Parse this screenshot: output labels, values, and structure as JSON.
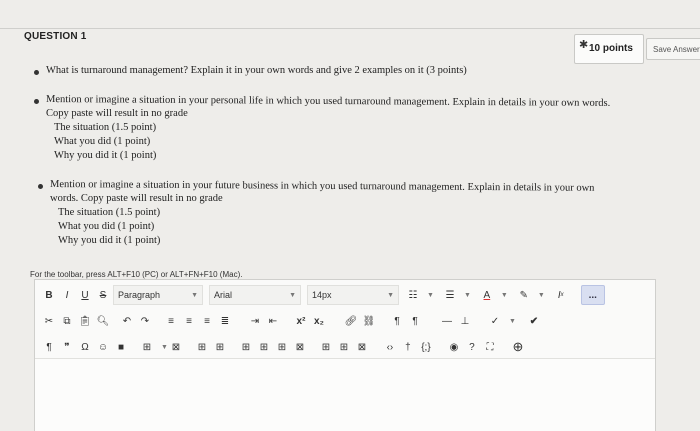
{
  "question": {
    "title": "QUESTION 1",
    "points": "10 points",
    "save_label": "Save Answer"
  },
  "bullets": [
    {
      "lines": [
        "What is turnaround management? Explain it in your own words and give 2 examples on it (3 points)"
      ]
    },
    {
      "lines": [
        "Mention or imagine a situation in your personal life in which you used turnaround management. Explain in details in your own words.",
        "Copy paste will result in no grade",
        "The situation (1.5 point)",
        "What you did (1 point)",
        "Why you did it (1 point)"
      ]
    },
    {
      "lines": [
        "Mention or imagine a situation in your future business in which you used turnaround management. Explain in details in your own",
        "words. Copy paste will result in no grade",
        "The situation (1.5 point)",
        "What you did (1 point)",
        "Why you did it (1 point)"
      ]
    }
  ],
  "toolbar_hint": "For the toolbar, press ALT+F10 (PC) or ALT+FN+F10 (Mac).",
  "toolbar": {
    "bold": "B",
    "italic": "I",
    "underline": "U",
    "strike": "S",
    "paragraph": "Paragraph",
    "font": "Arial",
    "size": "14px",
    "superscript": "x²",
    "subscript": "x₂",
    "more": "..."
  },
  "icons": {
    "chevron": "chevron-down-icon",
    "pin": "pin-icon"
  }
}
